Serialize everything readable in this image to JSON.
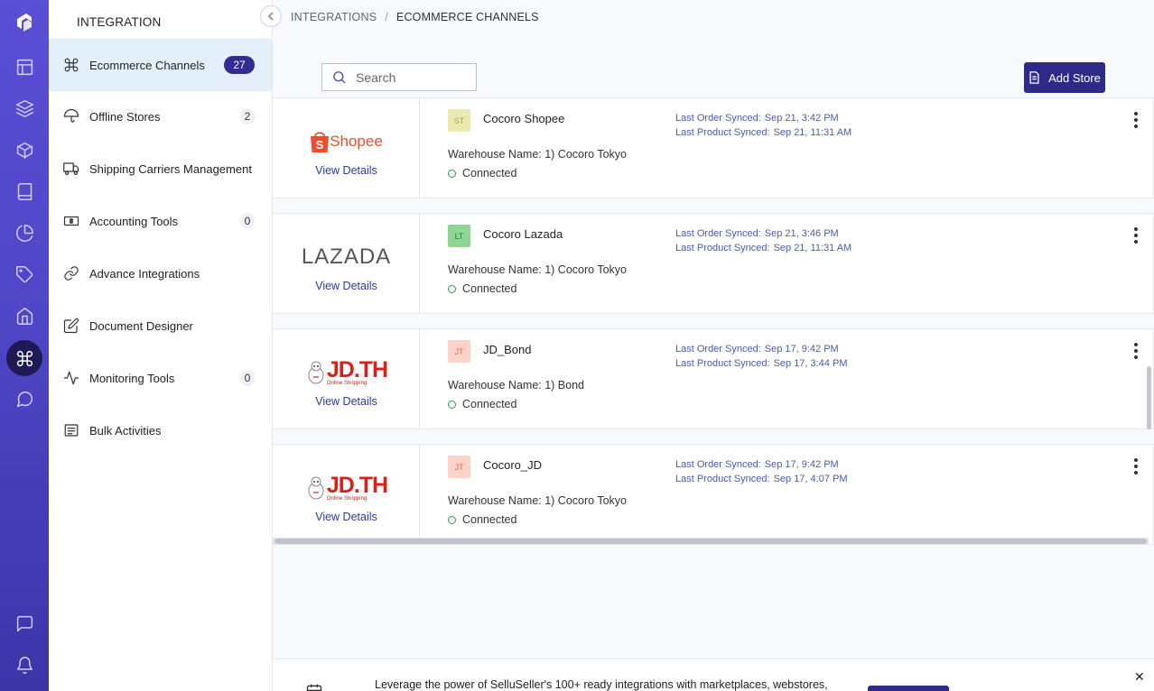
{
  "sidebar": {
    "title": "INTEGRATION",
    "items": [
      {
        "label": "Ecommerce Channels",
        "badge": "27",
        "icon": "command-icon",
        "active": true
      },
      {
        "label": "Offline Stores",
        "badge": "2",
        "icon": "umbrella-icon"
      },
      {
        "label": "Shipping Carriers Management",
        "badge": "",
        "icon": "truck-icon"
      },
      {
        "label": "Accounting Tools",
        "badge": "0",
        "icon": "money-icon"
      },
      {
        "label": "Advance Integrations",
        "badge": "",
        "icon": "link-icon"
      },
      {
        "label": "Document Designer",
        "badge": "",
        "icon": "edit-icon"
      },
      {
        "label": "Monitoring Tools",
        "badge": "0",
        "icon": "activity-icon"
      },
      {
        "label": "Bulk Activities",
        "badge": "",
        "icon": "list-icon"
      }
    ]
  },
  "rail": {
    "icons": [
      "logo-icon",
      "layout-icon",
      "layers-icon",
      "box-icon",
      "book-icon",
      "pie-chart-icon",
      "tag-icon",
      "home-icon",
      "command-icon",
      "message-circle-icon",
      "message-square-icon",
      "bell-icon"
    ],
    "active": "command-icon"
  },
  "breadcrumb": {
    "parent": "INTEGRATIONS",
    "separator": "/",
    "current": "ECOMMERCE CHANNELS"
  },
  "search": {
    "placeholder": "Search",
    "value": ""
  },
  "toolbar": {
    "add_store_label": "Add Store"
  },
  "stores": [
    {
      "brand": "Shopee",
      "view_details": "View Details",
      "initials": "ST",
      "avatar_bg": "#eceab0",
      "avatar_fg": "#a8a040",
      "name": "Cocoro Shopee",
      "warehouse": "Warehouse Name: 1) Cocoro Tokyo",
      "status": "Connected",
      "last_order_label": "Last Order Synced:",
      "last_order": "Sep 21, 3:42 PM",
      "last_product_label": "Last Product Synced:",
      "last_product": "Sep 21, 11:31 AM"
    },
    {
      "brand": "LAZADA",
      "view_details": "View Details",
      "initials": "LT",
      "avatar_bg": "#8fd694",
      "avatar_fg": "#2f7a36",
      "name": "Cocoro Lazada",
      "warehouse": "Warehouse Name: 1) Cocoro Tokyo",
      "status": "Connected",
      "last_order_label": "Last Order Synced:",
      "last_order": "Sep 21, 3:46 PM",
      "last_product_label": "Last Product Synced:",
      "last_product": "Sep 21, 11:31 AM"
    },
    {
      "brand": "JD.TH",
      "brand_sub": "Online Shopping",
      "view_details": "View Details",
      "initials": "JT",
      "avatar_bg": "#fbd3c8",
      "avatar_fg": "#e07050",
      "name": "JD_Bond",
      "warehouse": "Warehouse Name: 1) Bond",
      "status": "Connected",
      "last_order_label": "Last Order Synced:",
      "last_order": "Sep 17, 9:42 PM",
      "last_product_label": "Last Product Synced:",
      "last_product": "Sep 17, 3:44 PM"
    },
    {
      "brand": "JD.TH",
      "brand_sub": "Online Shopping",
      "view_details": "View Details",
      "initials": "JT",
      "avatar_bg": "#fbd3c8",
      "avatar_fg": "#e07050",
      "name": "Cocoro_JD",
      "warehouse": "Warehouse Name: 1) Cocoro Tokyo",
      "status": "Connected",
      "last_order_label": "Last Order Synced:",
      "last_order": "Sep 17, 9:42 PM",
      "last_product_label": "Last Product Synced:",
      "last_product": "Sep 17, 4:07 PM"
    }
  ],
  "banner": {
    "text": "Leverage the power of SelluSeller's 100+ ready integrations with marketplaces, webstores,",
    "close": "✕",
    "icon": "calendar-icon"
  },
  "colors": {
    "accent": "#2e2a8a",
    "rail_top": "#5a4fd6",
    "active_bg": "#e3effa",
    "connected": "#2e9d45",
    "link": "#2f3a9e"
  }
}
